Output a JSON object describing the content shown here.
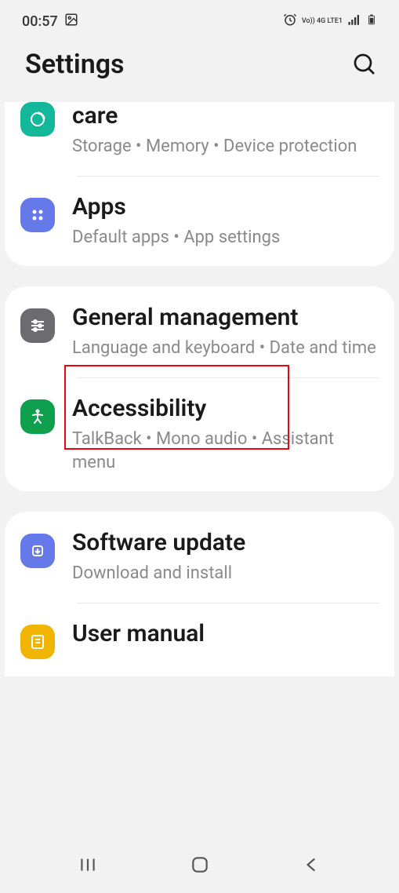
{
  "status": {
    "time": "00:57",
    "indicators": "Vo)) 4G LTE1"
  },
  "header": {
    "title": "Settings"
  },
  "groups": [
    {
      "items": [
        {
          "title": "care",
          "subtitle": "Storage  •  Memory  •  Device protection",
          "icon": "device-care-icon",
          "iconColor": "ic-teal"
        },
        {
          "title": "Apps",
          "subtitle": "Default apps  •  App settings",
          "icon": "apps-icon",
          "iconColor": "ic-blue"
        }
      ]
    },
    {
      "items": [
        {
          "title": "General management",
          "subtitle": "Language and keyboard  •  Date and time",
          "icon": "general-management-icon",
          "iconColor": "ic-gray"
        },
        {
          "title": "Accessibility",
          "subtitle": "TalkBack  •  Mono audio  •  Assistant menu",
          "icon": "accessibility-icon",
          "iconColor": "ic-green"
        }
      ]
    },
    {
      "items": [
        {
          "title": "Software update",
          "subtitle": "Download and install",
          "icon": "software-update-icon",
          "iconColor": "ic-blue2"
        },
        {
          "title": "User manual",
          "subtitle": "",
          "icon": "user-manual-icon",
          "iconColor": "ic-yellow"
        }
      ]
    }
  ]
}
